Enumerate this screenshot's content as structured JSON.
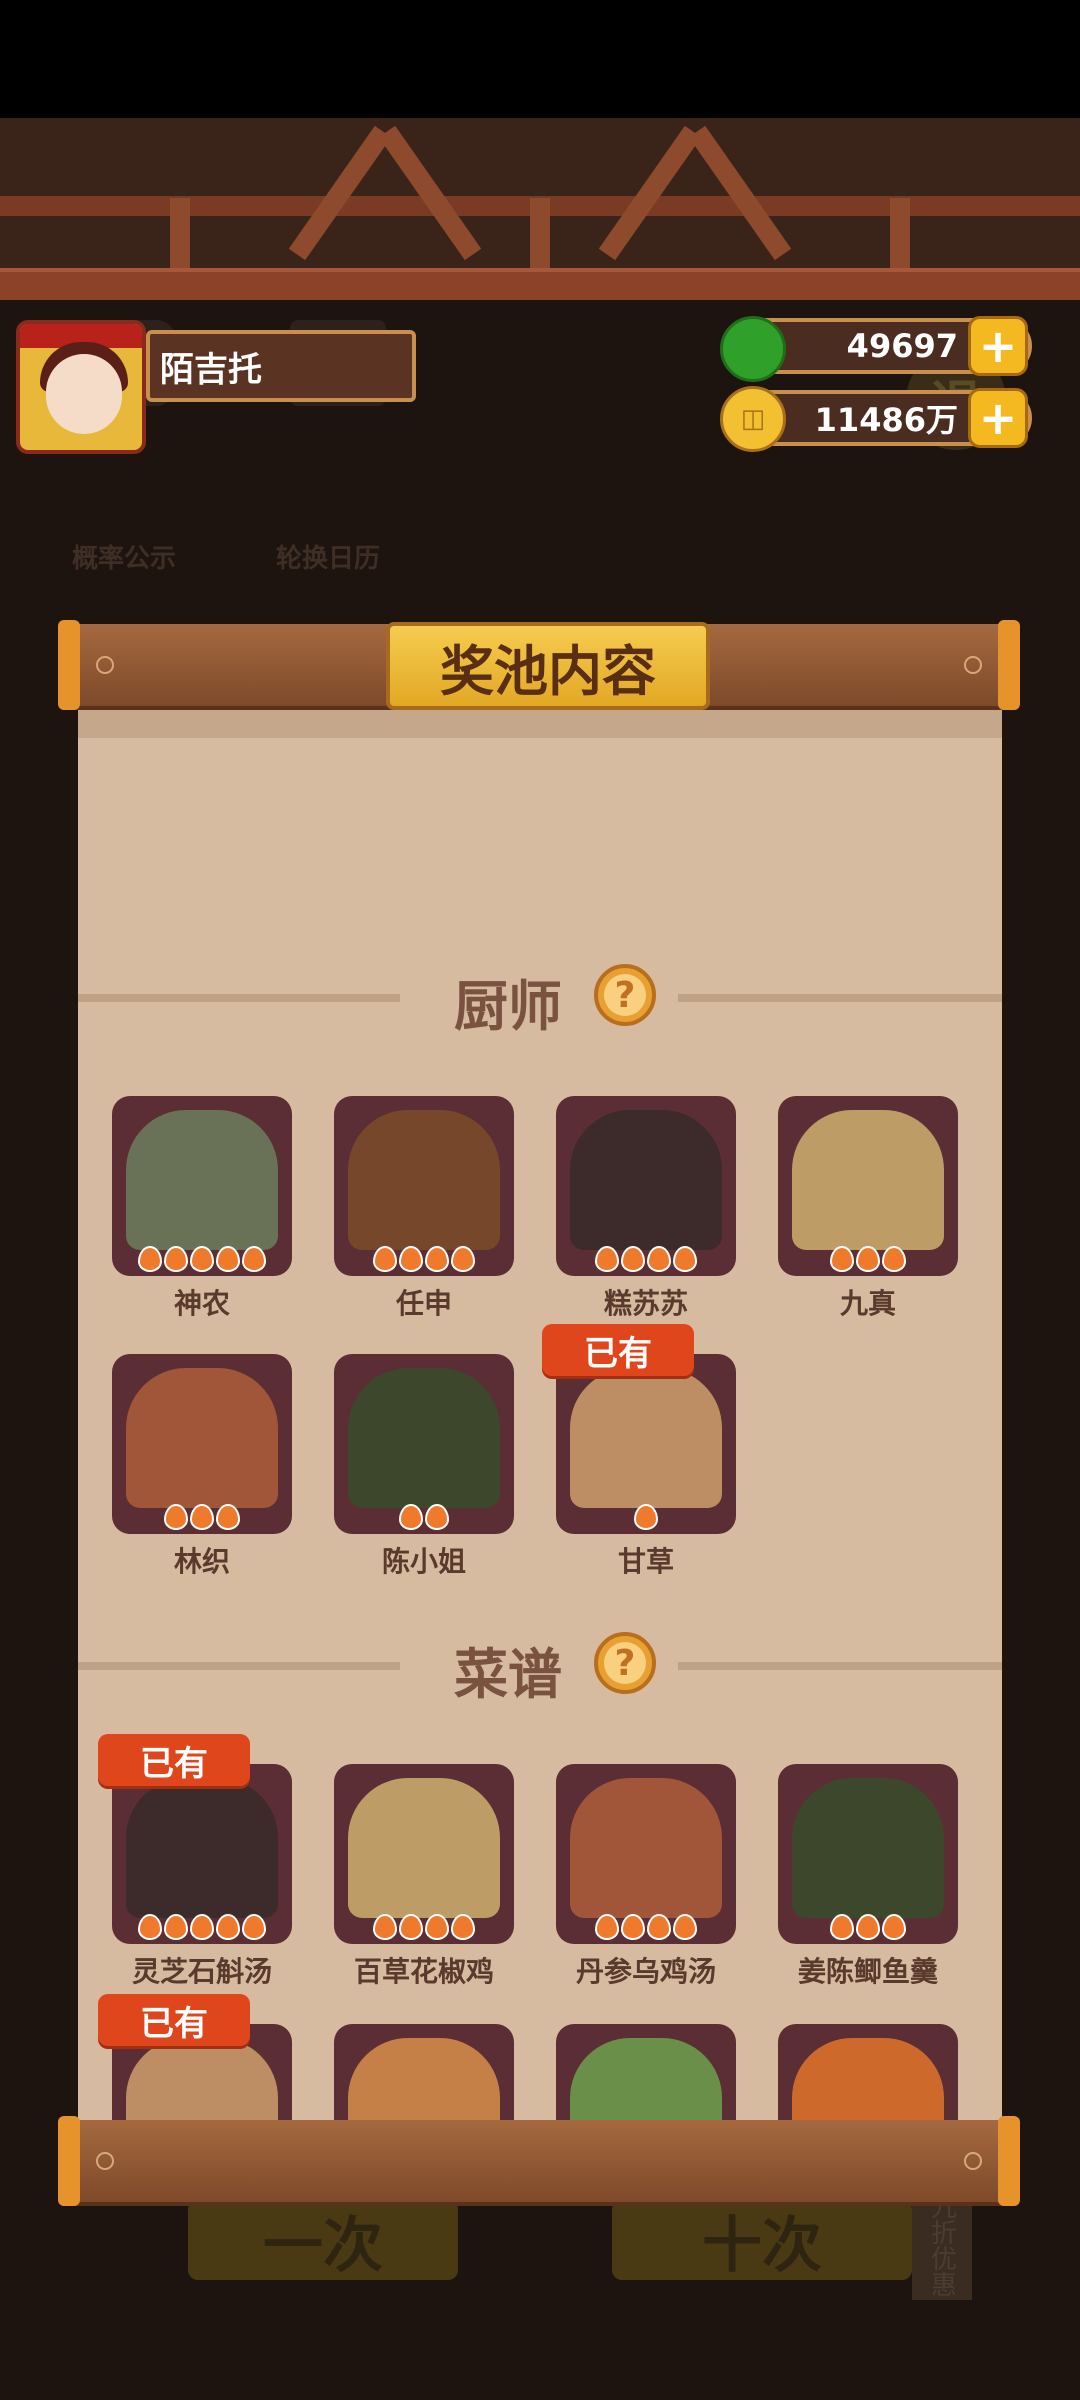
{
  "player": {
    "name": "陌吉托"
  },
  "currencies": [
    {
      "icon": "jade-icon",
      "value": "49697"
    },
    {
      "icon": "coin-icon",
      "value": "11486万"
    }
  ],
  "background": {
    "probability_label": "概率公示",
    "calendar_label": "轮换日历",
    "exit_label": "退",
    "single_draw": "一次",
    "ten_draw": "十次",
    "promo": "九折优惠"
  },
  "panel": {
    "title": "奖池内容",
    "owned_badge": "已有",
    "chef_section": {
      "title": "厨师",
      "items": [
        {
          "name": "神农",
          "stars": 5,
          "owned": false
        },
        {
          "name": "任申",
          "stars": 4,
          "owned": false
        },
        {
          "name": "糕苏苏",
          "stars": 4,
          "owned": false
        },
        {
          "name": "九真",
          "stars": 3,
          "owned": false
        },
        {
          "name": "林织",
          "stars": 3,
          "owned": false
        },
        {
          "name": "陈小姐",
          "stars": 2,
          "owned": false
        },
        {
          "name": "甘草",
          "stars": 1,
          "owned": true
        }
      ]
    },
    "recipe_section": {
      "title": "菜谱",
      "items": [
        {
          "name": "灵芝石斛汤",
          "stars": 5,
          "owned": true
        },
        {
          "name": "百草花椒鸡",
          "stars": 4,
          "owned": false
        },
        {
          "name": "丹参乌鸡汤",
          "stars": 4,
          "owned": false
        },
        {
          "name": "姜陈鲫鱼羹",
          "stars": 3,
          "owned": false
        },
        {
          "name": "",
          "stars": 0,
          "owned": true
        },
        {
          "name": "",
          "stars": 0,
          "owned": false
        },
        {
          "name": "",
          "stars": 0,
          "owned": false
        },
        {
          "name": "",
          "stars": 0,
          "owned": false
        }
      ]
    }
  },
  "colors": {
    "accent": "#e0461c",
    "gold": "#f4b820",
    "paper": "#d6bba0",
    "card": "#5a2e34"
  }
}
